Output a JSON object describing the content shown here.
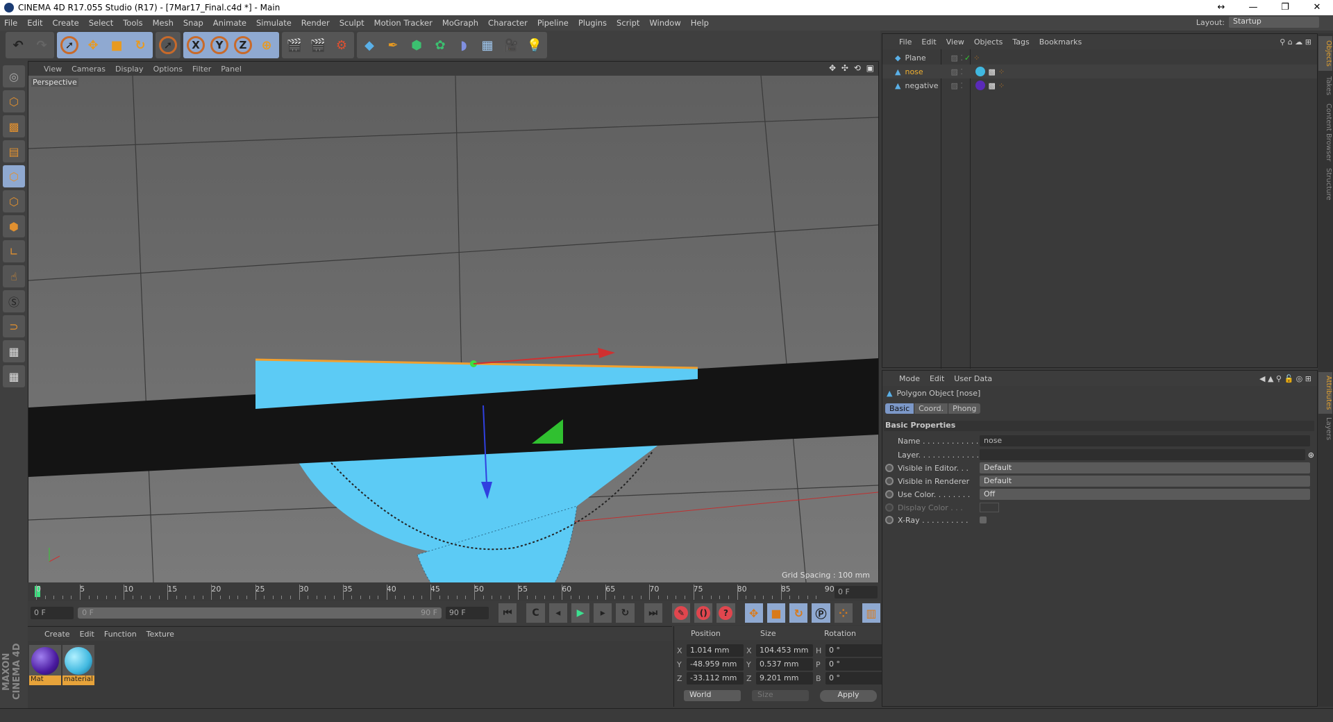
{
  "window": {
    "title": "CINEMA 4D R17.055 Studio (R17) - [7Mar17_Final.c4d *] - Main",
    "controls": [
      "↔",
      "—",
      "❐",
      "✕"
    ]
  },
  "menu": [
    "File",
    "Edit",
    "Create",
    "Select",
    "Tools",
    "Mesh",
    "Snap",
    "Animate",
    "Simulate",
    "Render",
    "Sculpt",
    "Motion Tracker",
    "MoGraph",
    "Character",
    "Pipeline",
    "Plugins",
    "Script",
    "Window",
    "Help"
  ],
  "layout": {
    "label": "Layout:",
    "value": "Startup"
  },
  "toolbar": {
    "axis": [
      "X",
      "Y",
      "Z"
    ]
  },
  "viewport": {
    "menu": [
      "View",
      "Cameras",
      "Display",
      "Options",
      "Filter",
      "Panel"
    ],
    "camera": "Perspective",
    "grid_spacing": "Grid Spacing : 100 mm",
    "colors": {
      "object": "#5ccbf5",
      "plank": "#141414",
      "highlight": "#f0a030"
    }
  },
  "timeline": {
    "ticks": [
      "0",
      "5",
      "10",
      "15",
      "20",
      "25",
      "30",
      "35",
      "40",
      "45",
      "50",
      "55",
      "60",
      "65",
      "70",
      "75",
      "80",
      "85",
      "90"
    ],
    "current_frame": "0 F",
    "start": "0 F",
    "range_start": "0 F",
    "range_end": "90 F",
    "end": "90 F"
  },
  "materials": {
    "menu": [
      "Create",
      "Edit",
      "Function",
      "Texture"
    ],
    "items": [
      {
        "name": "Mat",
        "color": "#5a2ab8"
      },
      {
        "name": "material",
        "color": "#4cc0e8"
      }
    ]
  },
  "coordinates": {
    "headers": [
      "Position",
      "Size",
      "Rotation"
    ],
    "rows": [
      {
        "pa": "X",
        "pos": "1.014 mm",
        "sa": "X",
        "size": "104.453 mm",
        "ra": "H",
        "rot": "0 °"
      },
      {
        "pa": "Y",
        "pos": "-48.959 mm",
        "sa": "Y",
        "size": "0.537 mm",
        "ra": "P",
        "rot": "0 °"
      },
      {
        "pa": "Z",
        "pos": "-33.112 mm",
        "sa": "Z",
        "size": "9.201 mm",
        "ra": "B",
        "rot": "0 °"
      }
    ],
    "space": "World",
    "size_mode": "Size",
    "apply": "Apply"
  },
  "objects": {
    "menu": [
      "File",
      "Edit",
      "View",
      "Objects",
      "Tags",
      "Bookmarks"
    ],
    "items": [
      {
        "name": "Plane",
        "selected": false
      },
      {
        "name": "nose",
        "selected": true
      },
      {
        "name": "negative",
        "selected": false
      }
    ]
  },
  "attributes": {
    "menu": [
      "Mode",
      "Edit",
      "User Data"
    ],
    "object_title": "Polygon Object [nose]",
    "tabs": [
      "Basic",
      "Coord.",
      "Phong"
    ],
    "section": "Basic Properties",
    "fields": {
      "name_label": "Name . . . . . . . . . . . .",
      "name": "nose",
      "layer_label": "Layer. . . . . . . . . . . . .",
      "vis_editor_label": "Visible in Editor. . .",
      "vis_editor": "Default",
      "vis_render_label": "Visible in Renderer",
      "vis_render": "Default",
      "use_color_label": "Use Color. . . . . . . .",
      "use_color": "Off",
      "display_color_label": "Display Color . . .",
      "xray_label": "X-Ray . . . . . . . . . ."
    }
  },
  "side_tabs": {
    "top": [
      "Objects",
      "Takes",
      "Content Browser",
      "Structure"
    ],
    "bottom": [
      "Attributes",
      "Layers"
    ]
  },
  "branding": "MAXON CINEMA 4D"
}
